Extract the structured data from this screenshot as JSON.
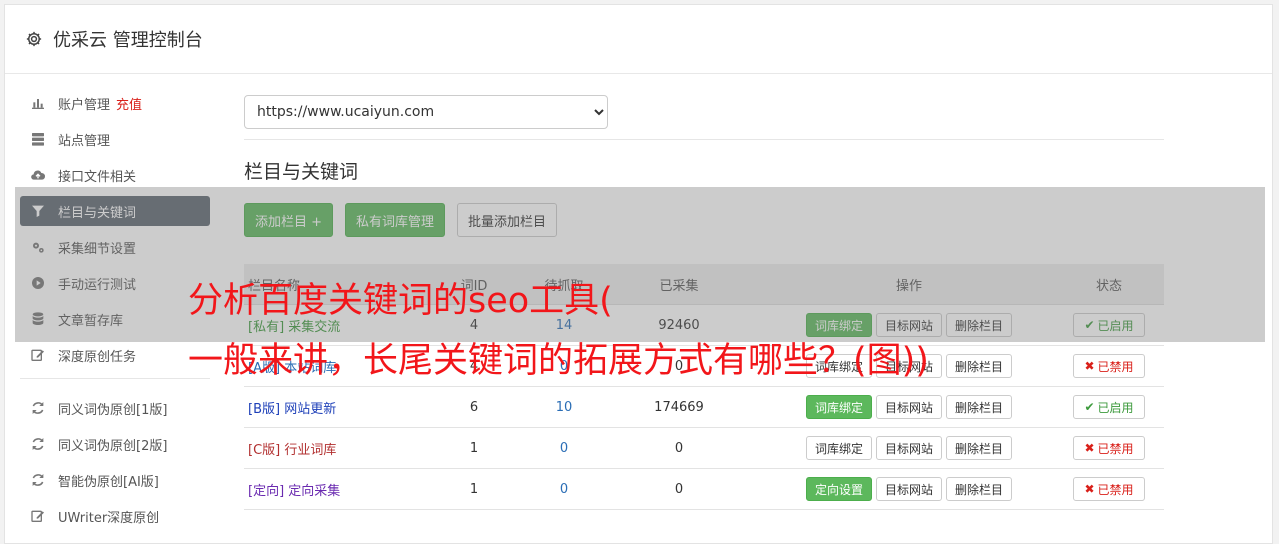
{
  "header": {
    "title": "优采云 管理控制台"
  },
  "sidebar": {
    "items": [
      {
        "label": "账户管理",
        "extra": "充值",
        "icon": "bar-chart-icon"
      },
      {
        "label": "站点管理",
        "icon": "server-icon"
      },
      {
        "label": "接口文件相关",
        "icon": "cloud-upload-icon"
      },
      {
        "label": "栏目与关键词",
        "icon": "filter-icon",
        "active": true
      },
      {
        "label": "采集细节设置",
        "icon": "cogs-icon"
      },
      {
        "label": "手动运行测试",
        "icon": "play-circle-icon"
      },
      {
        "label": "文章暂存库",
        "icon": "database-icon"
      },
      {
        "label": "深度原创任务",
        "icon": "edit-icon"
      }
    ],
    "group2": [
      {
        "label": "同义词伪原创[1版]",
        "icon": "refresh-icon"
      },
      {
        "label": "同义词伪原创[2版]",
        "icon": "refresh-icon"
      },
      {
        "label": "智能伪原创[AI版]",
        "icon": "refresh-icon"
      },
      {
        "label": "UWriter深度原创",
        "icon": "edit-icon"
      }
    ]
  },
  "main": {
    "site_select": "https://www.ucaiyun.com",
    "section_title": "栏目与关键词",
    "buttons": {
      "add_column": "添加栏目 +",
      "private_lib": "私有词库管理",
      "batch_add": "批量添加栏目"
    },
    "table": {
      "headers": [
        "栏目名称",
        "词ID",
        "待抓取",
        "已采集",
        "操作",
        "状态"
      ],
      "rows": [
        {
          "tag": "[私有]",
          "name": "采集交流",
          "c1": "4",
          "c2": "14",
          "c3": "92460",
          "op1": "词库绑定",
          "op1_green": true,
          "op2": "目标网站",
          "op3": "删除栏目",
          "status": "已启用",
          "on": true,
          "color": "#3c9a3c"
        },
        {
          "tag": "[A版]",
          "name": "本站词库",
          "c1": "4",
          "c2": "0",
          "c3": "0",
          "op1": "词库绑定",
          "op1_green": false,
          "op2": "目标网站",
          "op3": "删除栏目",
          "status": "已禁用",
          "on": false,
          "color": "#2a6db5"
        },
        {
          "tag": "[B版]",
          "name": "网站更新",
          "c1": "6",
          "c2": "10",
          "c3": "174669",
          "op1": "词库绑定",
          "op1_green": true,
          "op2": "目标网站",
          "op3": "删除栏目",
          "status": "已启用",
          "on": true,
          "color": "#1d3fb8"
        },
        {
          "tag": "[C版]",
          "name": "行业词库",
          "c1": "1",
          "c2": "0",
          "c3": "0",
          "op1": "词库绑定",
          "op1_green": false,
          "op2": "目标网站",
          "op3": "删除栏目",
          "status": "已禁用",
          "on": false,
          "color": "#b23030"
        },
        {
          "tag": "[定向]",
          "name": "定向采集",
          "c1": "1",
          "c2": "0",
          "c3": "0",
          "op1": "定向设置",
          "op1_green": true,
          "op2": "目标网站",
          "op3": "删除栏目",
          "status": "已禁用",
          "on": false,
          "color": "#6a2ab0"
        }
      ]
    }
  },
  "overlay": {
    "line1": "分析百度关键词的seo工具(",
    "line2": "一般来讲，长尾关键词的拓展方式有哪些？(图))"
  },
  "colors": {
    "accent_green": "#5cb85c",
    "active_nav": "#5d6670",
    "overlay_text": "#f2161a"
  }
}
